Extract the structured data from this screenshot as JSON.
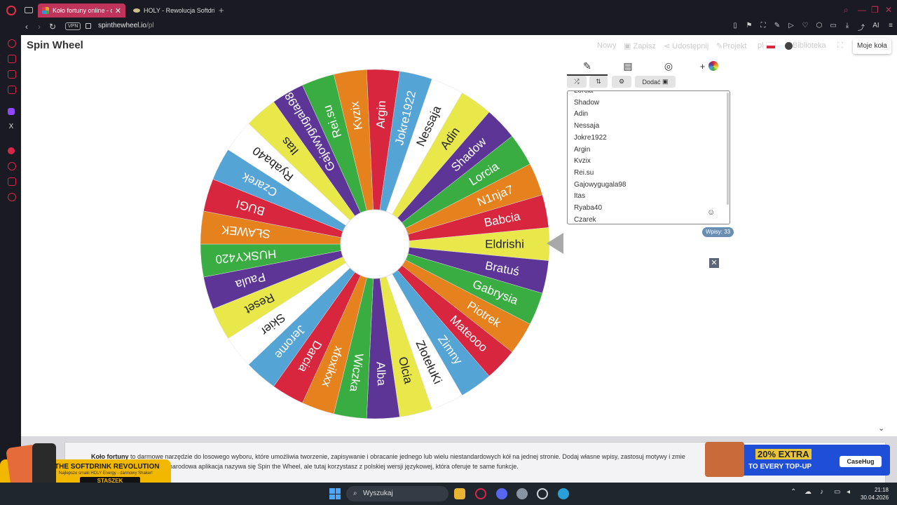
{
  "browser": {
    "tabs": [
      {
        "title": "Koło fortuny online - d",
        "active": true
      },
      {
        "title": "HOLY - Rewolucja Softdrin",
        "active": false
      }
    ],
    "url_host": "spinthewheel.io",
    "url_path": "/pl",
    "vpn_label": "VPN",
    "ai_label": "AI"
  },
  "site": {
    "logo": "Spin Wheel",
    "menu": {
      "new": "Nowy",
      "save": "Zapisz",
      "share": "Udostępnij",
      "projects": "Projekt",
      "lang": "pl",
      "library": "Biblioteka",
      "my_wheels": "Moje koła"
    }
  },
  "wheel": {
    "colors": [
      "#e8e84a",
      "#5c3596",
      "#3aad42",
      "#e5821e",
      "#d7263d",
      "#55a4d6",
      "#ffffff"
    ],
    "segments": [
      "Eldrishi",
      "Bratuś",
      "Gabrysia",
      "Piotrek",
      "Mateooo",
      "Zimny",
      "ZłotełuKi",
      "Olcia",
      "Alba",
      "Wiczka",
      "xfoxikxx",
      "Darcia",
      "Jerome",
      "Skier",
      "Reset",
      "Paula",
      "HUSKY420",
      "SŁAWEK",
      "BUGI",
      "Czarek",
      "Ryaba40",
      "Itas",
      "Gajowygugala98",
      "Rei.su",
      "Kvzix",
      "Argin",
      "Jokre1922",
      "Nessaja",
      "Adin",
      "Shadow",
      "Lorcia",
      "N1nja7",
      "Babcia"
    ]
  },
  "panel": {
    "add_label": "Dodać",
    "entries": [
      "Lorcia",
      "Shadow",
      "Adin",
      "Nessaja",
      "Jokre1922",
      "Argin",
      "Kvzix",
      "Rei.su",
      "Gajowygugala98",
      "Itas",
      "Ryaba40",
      "Czarek"
    ],
    "count_label": "Wpisy: 33"
  },
  "info": {
    "bold": "Koło fortuny",
    "line1": " to darmowe narzędzie do losowego wyboru, które umożliwia tworzenie, zapisywanie i obracanie jednego lub wielu niestandardowych kół na jednej stronie. Dodaj własne wpisy, zastosuj motywy i zmie",
    "line2": "zo za Ciebie. Nasza międzynarodowa aplikacja nazywa się Spin the Wheel, ale tutaj korzystasz z polskiej wersji językowej, która oferuje te same funkcje."
  },
  "ads": {
    "left_title": "THE SOFTDRINK REVOLUTION",
    "left_sub": "Najlepsze smaki HOLY Energy - darmowy Shaker!",
    "left_button": "STASZEK",
    "right_title": "20% EXTRA",
    "right_sub": "TO EVERY TOP-UP",
    "right_brand": "CaseHug"
  },
  "taskbar": {
    "search": "Wyszukaj",
    "time": "21:18",
    "date": "30.04.2026"
  }
}
